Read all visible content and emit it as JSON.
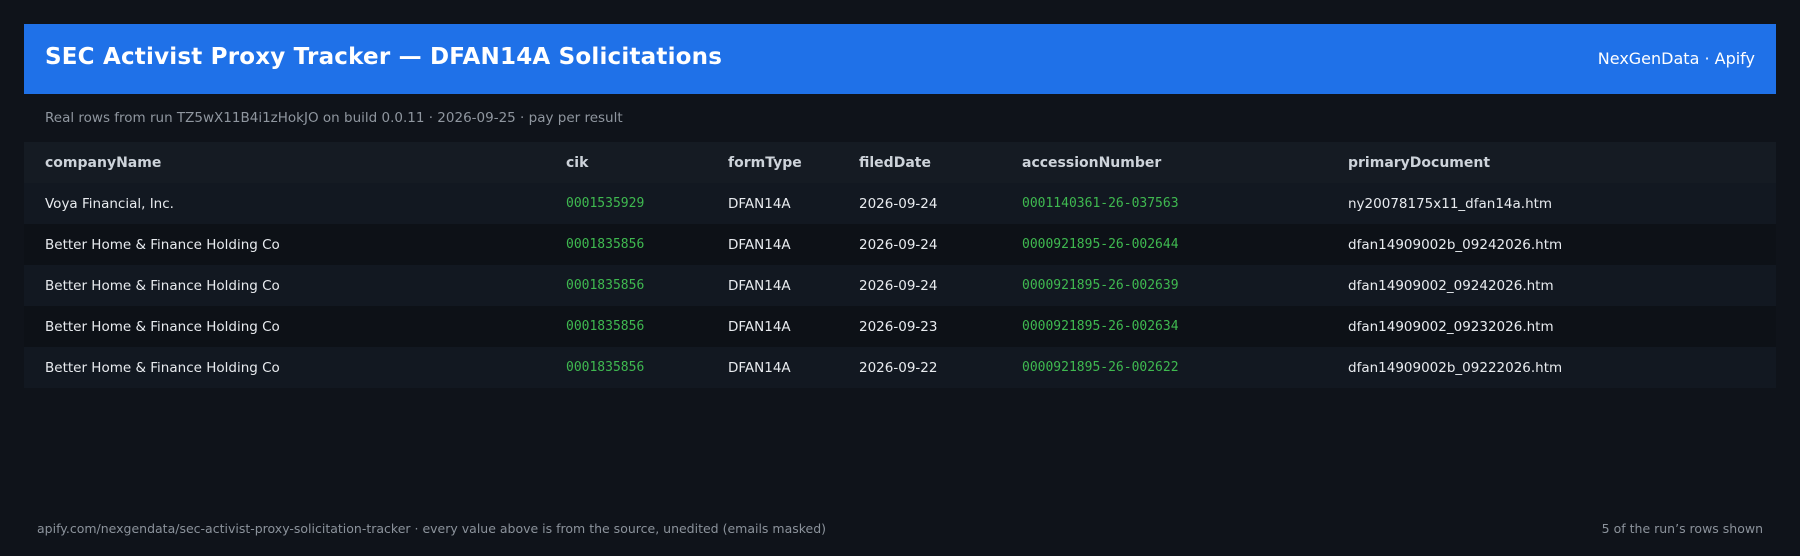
{
  "header": {
    "title": "SEC Activist Proxy Tracker — DFAN14A Solicitations",
    "brand": "NexGenData · Apify"
  },
  "subline": "Real rows from run TZ5wX11B4i1zHokJO on build 0.0.11 · 2026-09-25 · pay per result",
  "table": {
    "columns": [
      "companyName",
      "cik",
      "formType",
      "filedDate",
      "accessionNumber",
      "primaryDocument"
    ],
    "rows": [
      {
        "companyName": "Voya Financial, Inc.",
        "cik": "0001535929",
        "formType": "DFAN14A",
        "filedDate": "2026-09-24",
        "accessionNumber": "0001140361-26-037563",
        "primaryDocument": "ny20078175x11_dfan14a.htm"
      },
      {
        "companyName": "Better Home & Finance Holding Co",
        "cik": "0001835856",
        "formType": "DFAN14A",
        "filedDate": "2026-09-24",
        "accessionNumber": "0000921895-26-002644",
        "primaryDocument": "dfan14909002b_09242026.htm"
      },
      {
        "companyName": "Better Home & Finance Holding Co",
        "cik": "0001835856",
        "formType": "DFAN14A",
        "filedDate": "2026-09-24",
        "accessionNumber": "0000921895-26-002639",
        "primaryDocument": "dfan14909002_09242026.htm"
      },
      {
        "companyName": "Better Home & Finance Holding Co",
        "cik": "0001835856",
        "formType": "DFAN14A",
        "filedDate": "2026-09-23",
        "accessionNumber": "0000921895-26-002634",
        "primaryDocument": "dfan14909002_09232026.htm"
      },
      {
        "companyName": "Better Home & Finance Holding Co",
        "cik": "0001835856",
        "formType": "DFAN14A",
        "filedDate": "2026-09-22",
        "accessionNumber": "0000921895-26-002622",
        "primaryDocument": "dfan14909002b_09222026.htm"
      }
    ]
  },
  "footer": {
    "left": "apify.com/nexgendata/sec-activist-proxy-solicitation-tracker  ·  every value above is from the source, unedited (emails masked)",
    "right": "5 of the run’s rows shown"
  },
  "colors": {
    "background": "#0f131a",
    "header": "#1f71e8",
    "mono_accent": "#3fb950"
  }
}
